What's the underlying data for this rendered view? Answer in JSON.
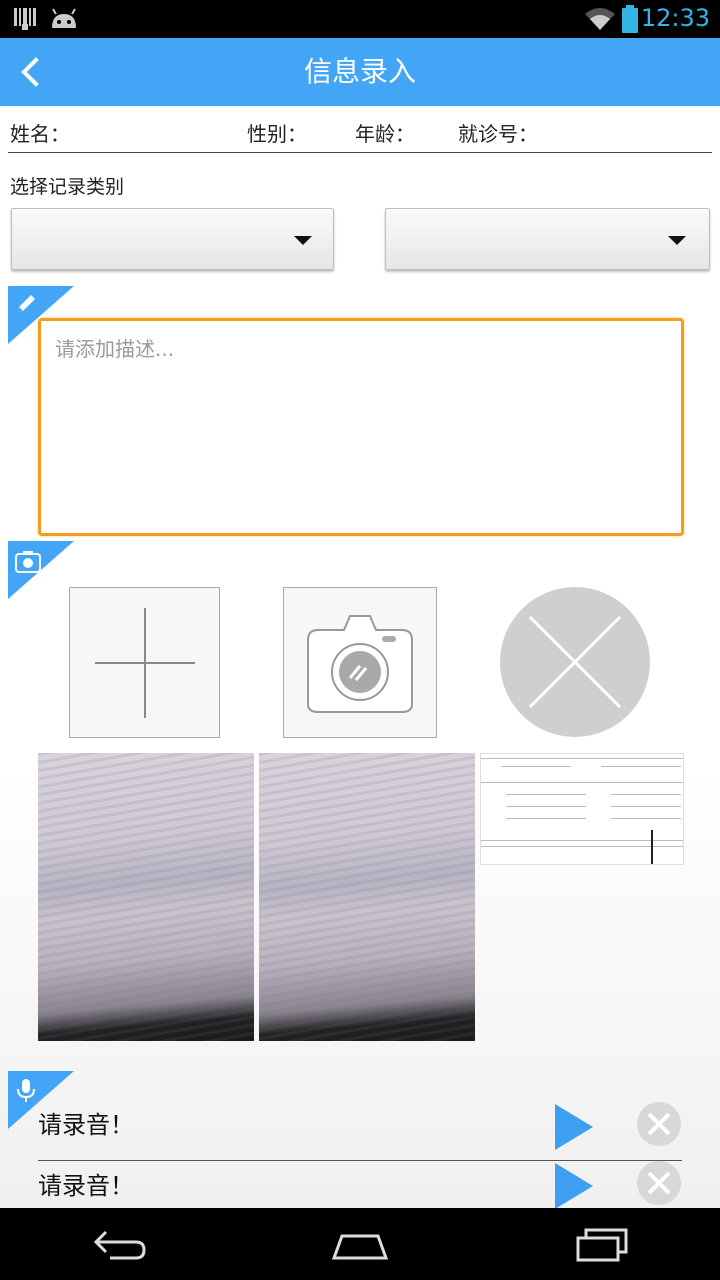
{
  "status_bar": {
    "time": "12:33",
    "icons": [
      "barcode-icon",
      "android-icon",
      "wifi-icon",
      "battery-icon"
    ]
  },
  "header": {
    "title": "信息录入",
    "back_icon": "chevron-left-icon"
  },
  "patient_info": {
    "name_label": "姓名：",
    "gender_label": "性别：",
    "age_label": "年龄：",
    "visit_no_label": "就诊号："
  },
  "record_type": {
    "label": "选择记录类别",
    "dropdown1_value": "",
    "dropdown2_value": ""
  },
  "description": {
    "placeholder": "请添加描述...",
    "value": ""
  },
  "photos": {
    "actions": [
      "add-photo-icon",
      "camera-icon",
      "delete-icon"
    ],
    "thumbnails": [
      "photo-1",
      "photo-2",
      "document-photo-3"
    ]
  },
  "audio": {
    "items": [
      {
        "label": "请录音！"
      },
      {
        "label": "请录音！"
      }
    ]
  },
  "colors": {
    "accent": "#42a5f5",
    "focus_border": "#f39c1f",
    "play": "#3e9ef0"
  }
}
